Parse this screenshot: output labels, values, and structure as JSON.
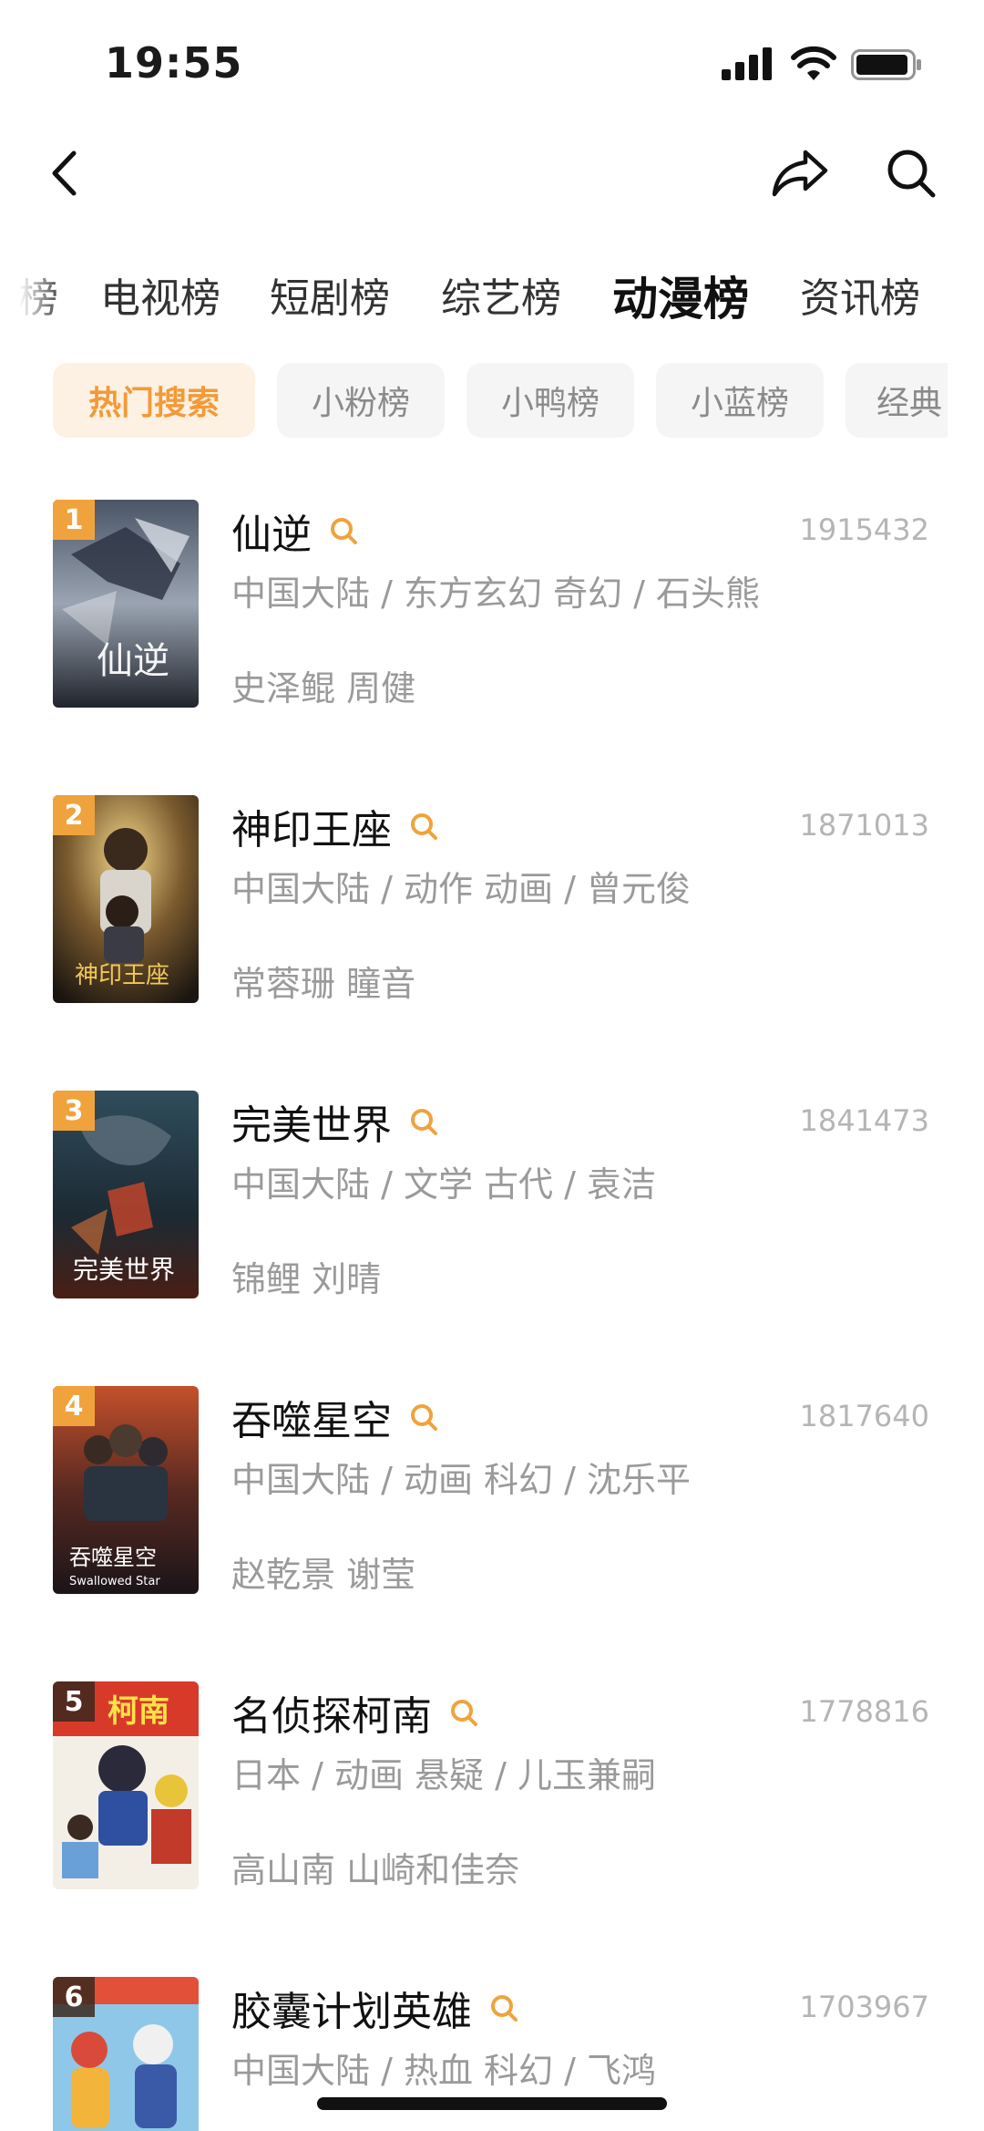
{
  "status": {
    "time": "19:55"
  },
  "category_tabs": {
    "partial_left": "榜",
    "tv": "电视榜",
    "short_drama": "短剧榜",
    "variety": "综艺榜",
    "anime": "动漫榜",
    "news": "资讯榜",
    "active": "动漫榜"
  },
  "sub_tabs": {
    "hot_search": "热门搜索",
    "pink": "小粉榜",
    "duck": "小鸭榜",
    "blue": "小蓝榜",
    "classic": "经典",
    "active": "热门搜索"
  },
  "colors": {
    "accent": "#f29a38",
    "rank_badge": "#f0a33c",
    "sub_tab_active_bg": "#fdf1e3",
    "secondary_text": "#9a9a9a"
  },
  "items": [
    {
      "rank": "1",
      "title": "仙逆",
      "score": "1915432",
      "meta": "中国大陆 / 东方玄幻 奇幻 / 石头熊",
      "cast": "史泽鲲 周健"
    },
    {
      "rank": "2",
      "title": "神印王座",
      "score": "1871013",
      "meta": "中国大陆 / 动作 动画 / 曾元俊",
      "cast": "常蓉珊 瞳音"
    },
    {
      "rank": "3",
      "title": "完美世界",
      "score": "1841473",
      "meta": "中国大陆 / 文学 古代 / 袁洁",
      "cast": "锦鲤 刘晴"
    },
    {
      "rank": "4",
      "title": "吞噬星空",
      "score": "1817640",
      "meta": "中国大陆 / 动画 科幻 / 沈乐平",
      "cast": "赵乾景 谢莹"
    },
    {
      "rank": "5",
      "title": "名侦探柯南",
      "score": "1778816",
      "meta": "日本 / 动画 悬疑 / 儿玉兼嗣",
      "cast": "高山南 山崎和佳奈"
    },
    {
      "rank": "6",
      "title": "胶囊计划英雄",
      "score": "1703967",
      "meta": "中国大陆 / 热血 科幻 / 飞鸿",
      "cast": ""
    }
  ],
  "poster_art_text": {
    "p1": "仙逆",
    "p2": "神印王座",
    "p3": "完美世界",
    "p4a": "吞噬星空",
    "p4b": "Swallowed Star",
    "p5": "柯南"
  }
}
